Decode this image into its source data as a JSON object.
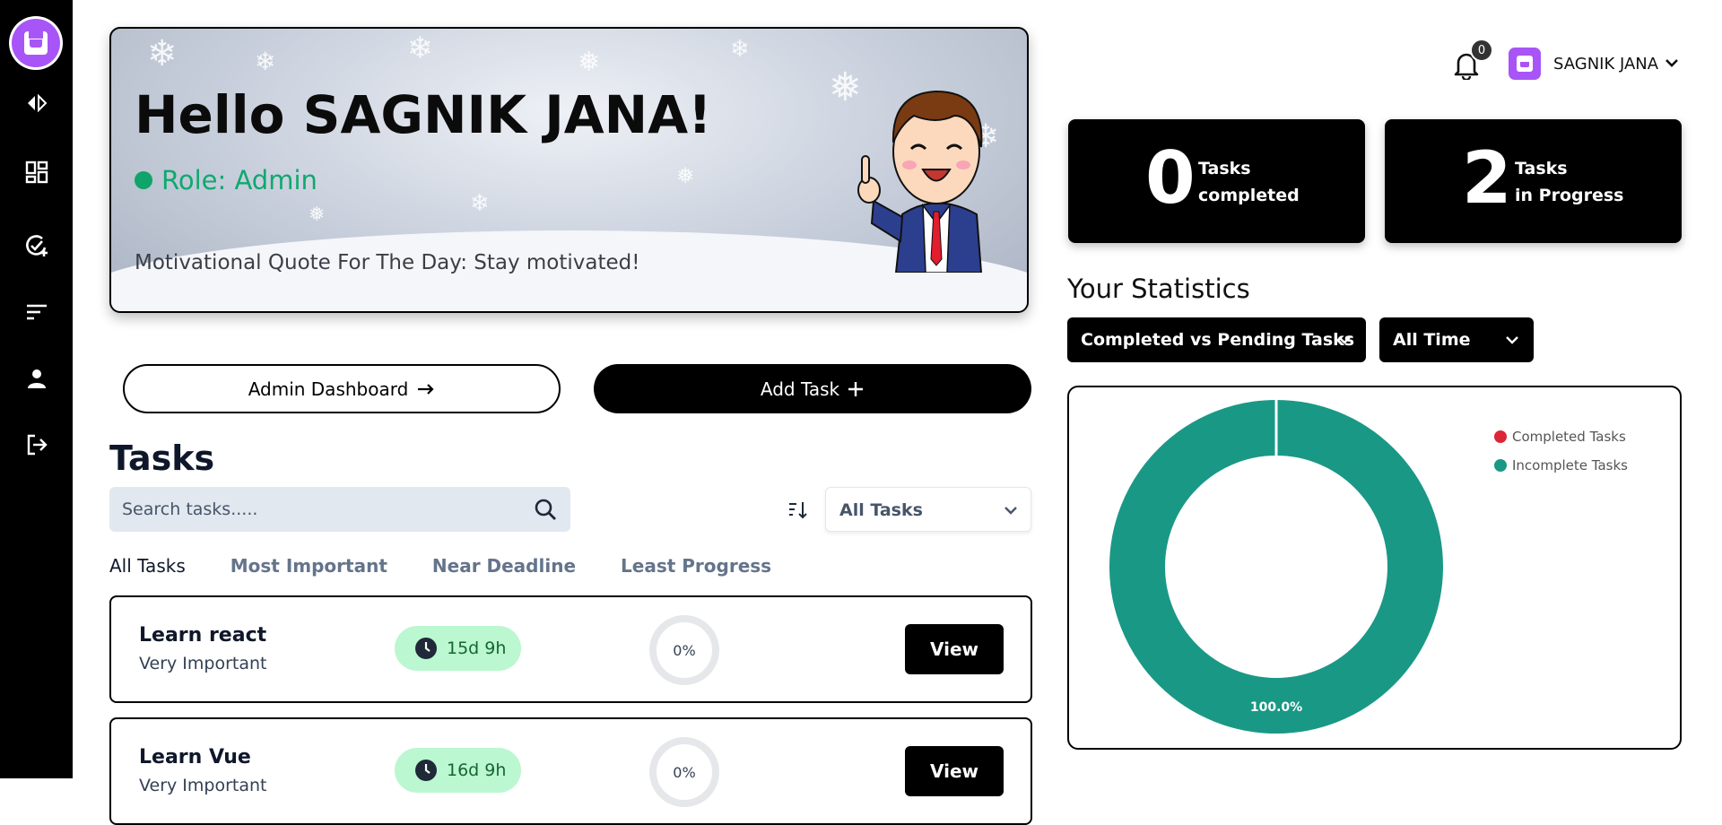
{
  "sidebar": {
    "toggle_icon": "collapse-expand-icon",
    "items": [
      {
        "icon": "dashboard-icon"
      },
      {
        "icon": "add-task-icon"
      },
      {
        "icon": "sort-list-icon"
      },
      {
        "icon": "profile-icon"
      },
      {
        "icon": "logout-icon"
      }
    ]
  },
  "hero": {
    "greeting": "Hello SAGNIK JANA!",
    "role": "Role: Admin",
    "quote": "Motivational Quote For The Day: Stay motivated!"
  },
  "actions": {
    "admin_dashboard": "Admin Dashboard",
    "add_task": "Add Task"
  },
  "tasks_section": {
    "title": "Tasks",
    "search_placeholder": "Search tasks.....",
    "filter_value": "All Tasks",
    "tabs": [
      "All Tasks",
      "Most Important",
      "Near Deadline",
      "Least Progress"
    ],
    "items": [
      {
        "name": "Learn react",
        "importance": "Very Important",
        "time_left": "15d 9h",
        "progress": "0%",
        "action": "View"
      },
      {
        "name": "Learn Vue",
        "importance": "Very Important",
        "time_left": "16d 9h",
        "progress": "0%",
        "action": "View"
      }
    ]
  },
  "header": {
    "notification_count": "0",
    "user_name": "SAGNIK JANA"
  },
  "stats": {
    "completed": {
      "value": "0",
      "label_line1": "Tasks",
      "label_line2": "completed"
    },
    "in_progress": {
      "value": "2",
      "label_line1": "Tasks",
      "label_line2": "in Progress"
    },
    "title": "Your Statistics",
    "chart_selector": "Completed vs Pending Tasks",
    "time_selector": "All Time"
  },
  "colors": {
    "completed": "#dc2638",
    "incomplete": "#1a9886",
    "accent_purple": "#a855f7"
  },
  "chart_data": {
    "type": "pie",
    "donut": true,
    "categories": [
      "Completed Tasks",
      "Incomplete Tasks"
    ],
    "values": [
      0,
      100
    ],
    "data_labels": [
      "",
      "100.0%"
    ],
    "legend": "top-right"
  }
}
